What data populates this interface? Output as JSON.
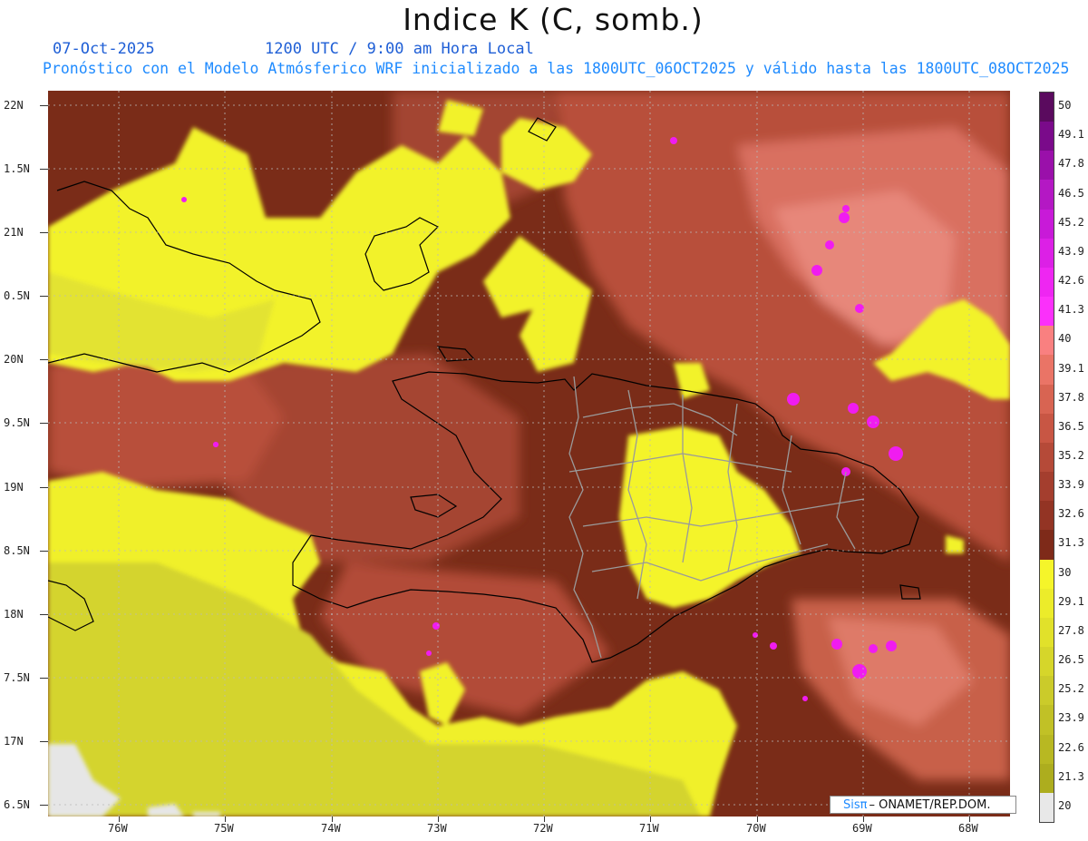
{
  "title": "Indice K (C, somb.)",
  "subtitle_date": "07-Oct-2025",
  "subtitle_time": "1200 UTC / 9:00 am Hora Local",
  "subtitle_model": "Pronóstico con el Modelo Atmósferico WRF inicializado a las 1800UTC_06OCT2025 y válido hasta las  1800UTC_08OCT2025",
  "credit_logo": "Sisπ",
  "credit_text": "– ONAMET/REP.DOM.",
  "lat_labels": [
    "22N",
    "1.5N",
    "21N",
    "0.5N",
    "20N",
    "9.5N",
    "19N",
    "8.5N",
    "18N",
    "7.5N",
    "17N",
    "6.5N"
  ],
  "lon_labels": [
    "76W",
    "75W",
    "74W",
    "73W",
    "72W",
    "71W",
    "70W",
    "69W",
    "68W"
  ],
  "colorbar": {
    "labels": [
      "50",
      "49.1",
      "47.8",
      "46.5",
      "45.2",
      "43.9",
      "42.6",
      "41.3",
      "40",
      "39.1",
      "37.8",
      "36.5",
      "35.2",
      "33.9",
      "32.6",
      "31.3",
      "30",
      "29.1",
      "27.8",
      "26.5",
      "25.2",
      "23.9",
      "22.6",
      "21.3",
      "20"
    ],
    "colors": [
      "#5a0a5e",
      "#7a0a8a",
      "#9a10aa",
      "#b418c4",
      "#c81ad8",
      "#dc20e6",
      "#ee26f2",
      "#fb30fb",
      "#f98080",
      "#ea7466",
      "#d86452",
      "#c85644",
      "#b54a38",
      "#a43e2e",
      "#933424",
      "#7e2a19",
      "#f5f52a",
      "#ecec2a",
      "#e1e12a",
      "#d6d62a",
      "#cbcb2a",
      "#c1c126",
      "#b8b822",
      "#adad1e",
      "#e8e8e8"
    ]
  },
  "legend_colors": {
    "ocean_dark": "#7a2c18",
    "mid_brown": "#a54532",
    "salmon": "#dc7a66",
    "pink": "#ee8a7a",
    "yellow": "#f5f52a",
    "olive_yellow": "#d7d72e",
    "magenta": "#f21cf2",
    "land_border": "#000000",
    "province_border": "#9a9a9a"
  }
}
